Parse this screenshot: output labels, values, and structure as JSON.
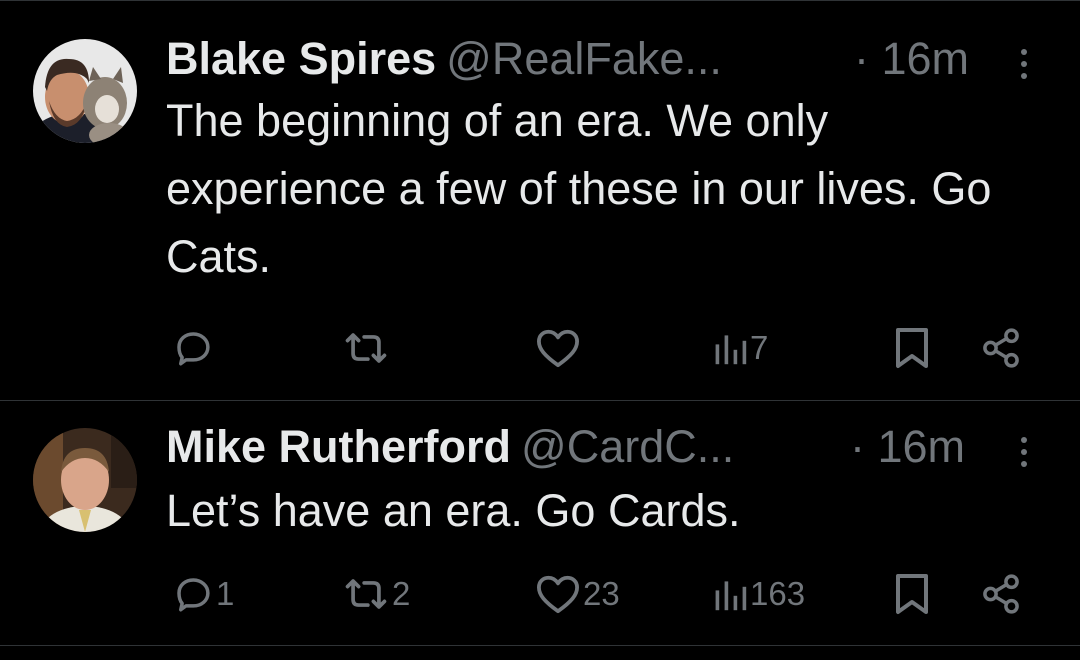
{
  "colors": {
    "background": "#000000",
    "primary_text": "#e7e9ea",
    "secondary_text": "#71767b",
    "divider": "#2f3336"
  },
  "tweets": [
    {
      "author": {
        "name": "Blake Spires",
        "handle": "@RealFake...",
        "avatar": "profile-photo-man-with-cat"
      },
      "time": "· 16m",
      "text": "The beginning of an era. We only experience a few of these in our lives. Go Cats.",
      "actions": {
        "reply_count": "",
        "repost_count": "",
        "like_count": "",
        "views_count": "7"
      }
    },
    {
      "author": {
        "name": "Mike Rutherford",
        "handle": "@CardC...",
        "avatar": "profile-photo-man-in-shirt"
      },
      "time": "· 16m",
      "text": "Let’s have an era. Go Cards.",
      "actions": {
        "reply_count": "1",
        "repost_count": "2",
        "like_count": "23",
        "views_count": "163"
      }
    }
  ],
  "icons": {
    "reply": "speech-bubble-icon",
    "repost": "repost-arrows-icon",
    "like": "heart-icon",
    "views": "bar-chart-icon",
    "bookmark": "bookmark-icon",
    "share": "share-nodes-icon",
    "more": "vertical-ellipsis-icon"
  }
}
